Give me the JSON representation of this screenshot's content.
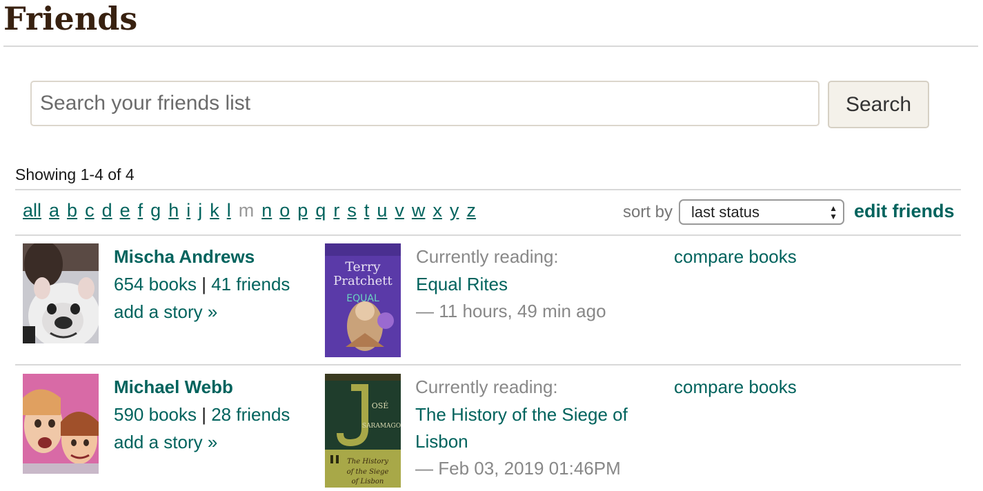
{
  "page": {
    "title": "Friends"
  },
  "search": {
    "placeholder": "Search your friends list",
    "button_label": "Search"
  },
  "showing": "Showing 1-4 of 4",
  "letters": [
    "all",
    "a",
    "b",
    "c",
    "d",
    "e",
    "f",
    "g",
    "h",
    "i",
    "j",
    "k",
    "l",
    "m",
    "n",
    "o",
    "p",
    "q",
    "r",
    "s",
    "t",
    "u",
    "v",
    "w",
    "x",
    "y",
    "z"
  ],
  "inactive_letter": "m",
  "sort": {
    "label": "sort by",
    "selected": "last status"
  },
  "edit_friends": "edit friends",
  "friends": [
    {
      "name": "Mischa Andrews",
      "books": "654 books",
      "separator": "|",
      "friends": "41 friends",
      "add_story": "add a story »",
      "status_label": "Currently reading:",
      "book_title": "Equal Rites",
      "book_title_line2": "",
      "time": "— 11 hours, 49 min ago",
      "compare": "compare books",
      "cover_author": "Terry\nPratchett",
      "cover_title": "EQUAL RITES"
    },
    {
      "name": "Michael Webb",
      "books": "590 books",
      "separator": "|",
      "friends": "28 friends",
      "add_story": "add a story »",
      "status_label": "Currently reading:",
      "book_title": "The History of the Siege of",
      "book_title_line2": "Lisbon",
      "time": "— Feb 03, 2019 01:46PM",
      "compare": "compare books",
      "cover_author": "JOSÉ SARAMAGO",
      "cover_title": "The History of the Siege of Lisbon"
    }
  ],
  "colors": {
    "link": "#00635d",
    "title": "#382110",
    "muted": "#888888"
  }
}
